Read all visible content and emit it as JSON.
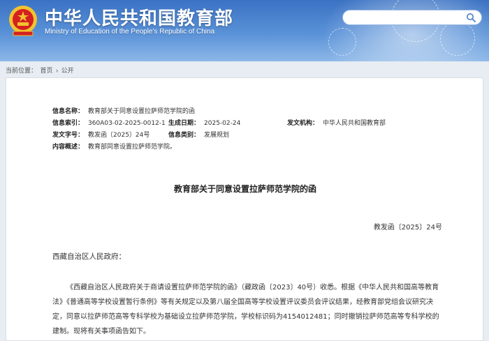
{
  "header": {
    "title_cn": "中华人民共和国教育部",
    "title_en": "Ministry of Education of the People's Republic of China",
    "search_placeholder": ""
  },
  "breadcrumb": {
    "prefix": "当前位置：",
    "items": [
      "首页",
      "公开"
    ],
    "separator": "›"
  },
  "meta": {
    "info_name_label": "信息名称：",
    "info_name_value": "教育部关于同意设置拉萨师范学院的函",
    "index_label": "信息索引：",
    "index_value": "360A03-02-2025-0012-1",
    "date_label": "生成日期：",
    "date_value": "2025-02-24",
    "issuer_label": "发文机构：",
    "issuer_value": "中华人民共和国教育部",
    "doc_no_label": "发文字号：",
    "doc_no_value": "教发函〔2025〕24号",
    "category_label": "信息类别：",
    "category_value": "发展规划",
    "summary_label": "内容概述：",
    "summary_value": "教育部同意设置拉萨师范学院。"
  },
  "document": {
    "title": "教育部关于同意设置拉萨师范学院的函",
    "number": "教发函〔2025〕24号",
    "salutation": "西藏自治区人民政府：",
    "paragraph": "《西藏自治区人民政府关于商请设置拉萨师范学院的函》（藏政函〔2023〕40号）收悉。根据《中华人民共和国高等教育法》《普通高等学校设置暂行条例》等有关规定以及第八届全国高等学校设置评议委员会评议结果，经教育部党组会议研究决定，同意以拉萨师范高等专科学校为基础设立拉萨师范学院，学校标识码为4154012481；同时撤销拉萨师范高等专科学校的建制。现将有关事项函告如下。"
  },
  "colors": {
    "header_blue": "#3b72c3",
    "emblem_red": "#d42020",
    "emblem_gold": "#f2c230"
  }
}
